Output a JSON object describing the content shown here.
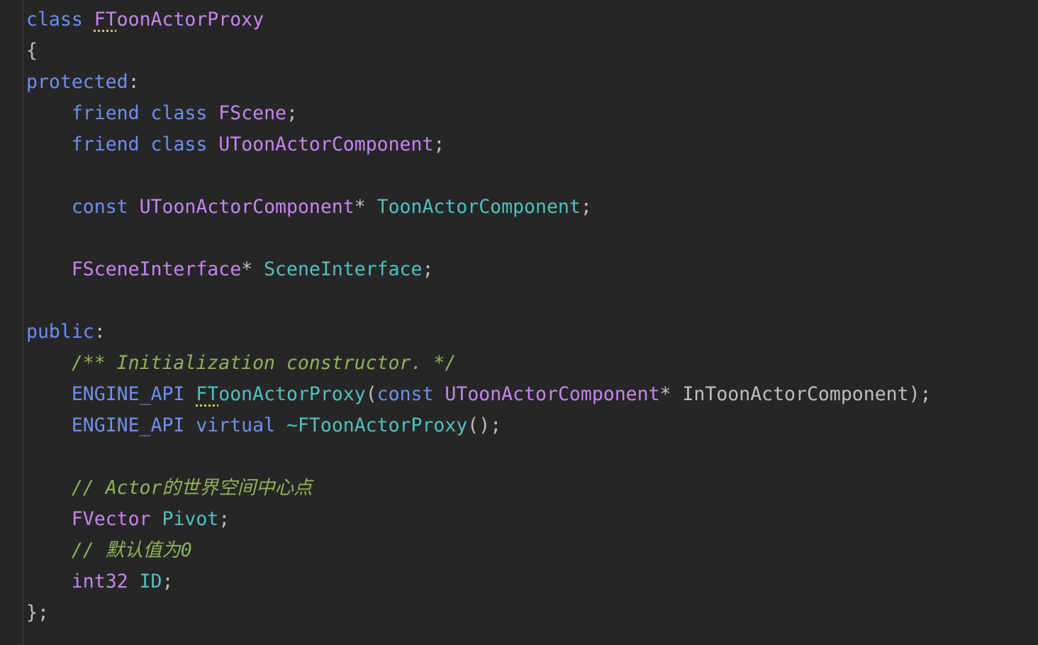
{
  "editor": {
    "language": "cpp",
    "colors": {
      "background": "#262626",
      "keyword": "#6f8ff0",
      "type": "#c685f0",
      "field": "#4fc1c1",
      "comment": "#8fb35a",
      "plain": "#bcbec4"
    },
    "lines": [
      [
        {
          "t": "class",
          "k": "kw"
        },
        {
          "t": " ",
          "k": "plain"
        },
        {
          "t": "FToonActorProxy",
          "k": "type",
          "dotted_prefix": "FT"
        }
      ],
      [
        {
          "t": "{",
          "k": "punc"
        }
      ],
      [
        {
          "t": "protected",
          "k": "kw"
        },
        {
          "t": ":",
          "k": "punc"
        }
      ],
      [
        {
          "t": "    ",
          "k": "plain"
        },
        {
          "t": "friend",
          "k": "kw"
        },
        {
          "t": " ",
          "k": "plain"
        },
        {
          "t": "class",
          "k": "kw"
        },
        {
          "t": " ",
          "k": "plain"
        },
        {
          "t": "FScene",
          "k": "type"
        },
        {
          "t": ";",
          "k": "punc"
        }
      ],
      [
        {
          "t": "    ",
          "k": "plain"
        },
        {
          "t": "friend",
          "k": "kw"
        },
        {
          "t": " ",
          "k": "plain"
        },
        {
          "t": "class",
          "k": "kw"
        },
        {
          "t": " ",
          "k": "plain"
        },
        {
          "t": "UToonActorComponent",
          "k": "type"
        },
        {
          "t": ";",
          "k": "punc"
        }
      ],
      [],
      [
        {
          "t": "    ",
          "k": "plain"
        },
        {
          "t": "const",
          "k": "kw"
        },
        {
          "t": " ",
          "k": "plain"
        },
        {
          "t": "UToonActorComponent",
          "k": "type"
        },
        {
          "t": "* ",
          "k": "punc"
        },
        {
          "t": "ToonActorComponent",
          "k": "field"
        },
        {
          "t": ";",
          "k": "punc"
        }
      ],
      [],
      [
        {
          "t": "    ",
          "k": "plain"
        },
        {
          "t": "FSceneInterface",
          "k": "type"
        },
        {
          "t": "* ",
          "k": "punc"
        },
        {
          "t": "SceneInterface",
          "k": "field"
        },
        {
          "t": ";",
          "k": "punc"
        }
      ],
      [],
      [
        {
          "t": "public",
          "k": "kw"
        },
        {
          "t": ":",
          "k": "punc"
        }
      ],
      [
        {
          "t": "    ",
          "k": "plain"
        },
        {
          "t": "/** Initialization constructor. */",
          "k": "comment"
        }
      ],
      [
        {
          "t": "    ",
          "k": "plain"
        },
        {
          "t": "ENGINE_API",
          "k": "macro"
        },
        {
          "t": " ",
          "k": "plain"
        },
        {
          "t": "FToonActorProxy",
          "k": "fn",
          "dotted_prefix": "FT"
        },
        {
          "t": "(",
          "k": "punc"
        },
        {
          "t": "const",
          "k": "kw"
        },
        {
          "t": " ",
          "k": "plain"
        },
        {
          "t": "UToonActorComponent",
          "k": "type"
        },
        {
          "t": "* ",
          "k": "punc"
        },
        {
          "t": "InToonActorComponent",
          "k": "param"
        },
        {
          "t": ");",
          "k": "punc"
        }
      ],
      [
        {
          "t": "    ",
          "k": "plain"
        },
        {
          "t": "ENGINE_API",
          "k": "macro"
        },
        {
          "t": " ",
          "k": "plain"
        },
        {
          "t": "virtual",
          "k": "kw"
        },
        {
          "t": " ",
          "k": "plain"
        },
        {
          "t": "~FToonActorProxy",
          "k": "fn"
        },
        {
          "t": "();",
          "k": "punc"
        }
      ],
      [],
      [
        {
          "t": "    ",
          "k": "plain"
        },
        {
          "t": "// Actor的世界空间中心点",
          "k": "comment"
        }
      ],
      [
        {
          "t": "    ",
          "k": "plain"
        },
        {
          "t": "FVector",
          "k": "type"
        },
        {
          "t": " ",
          "k": "plain"
        },
        {
          "t": "Pivot",
          "k": "field"
        },
        {
          "t": ";",
          "k": "punc"
        }
      ],
      [
        {
          "t": "    ",
          "k": "plain"
        },
        {
          "t": "// 默认值为0",
          "k": "comment"
        }
      ],
      [
        {
          "t": "    ",
          "k": "plain"
        },
        {
          "t": "int32",
          "k": "type"
        },
        {
          "t": " ",
          "k": "plain"
        },
        {
          "t": "ID",
          "k": "field"
        },
        {
          "t": ";",
          "k": "punc"
        }
      ],
      [
        {
          "t": "};",
          "k": "punc"
        }
      ]
    ]
  }
}
